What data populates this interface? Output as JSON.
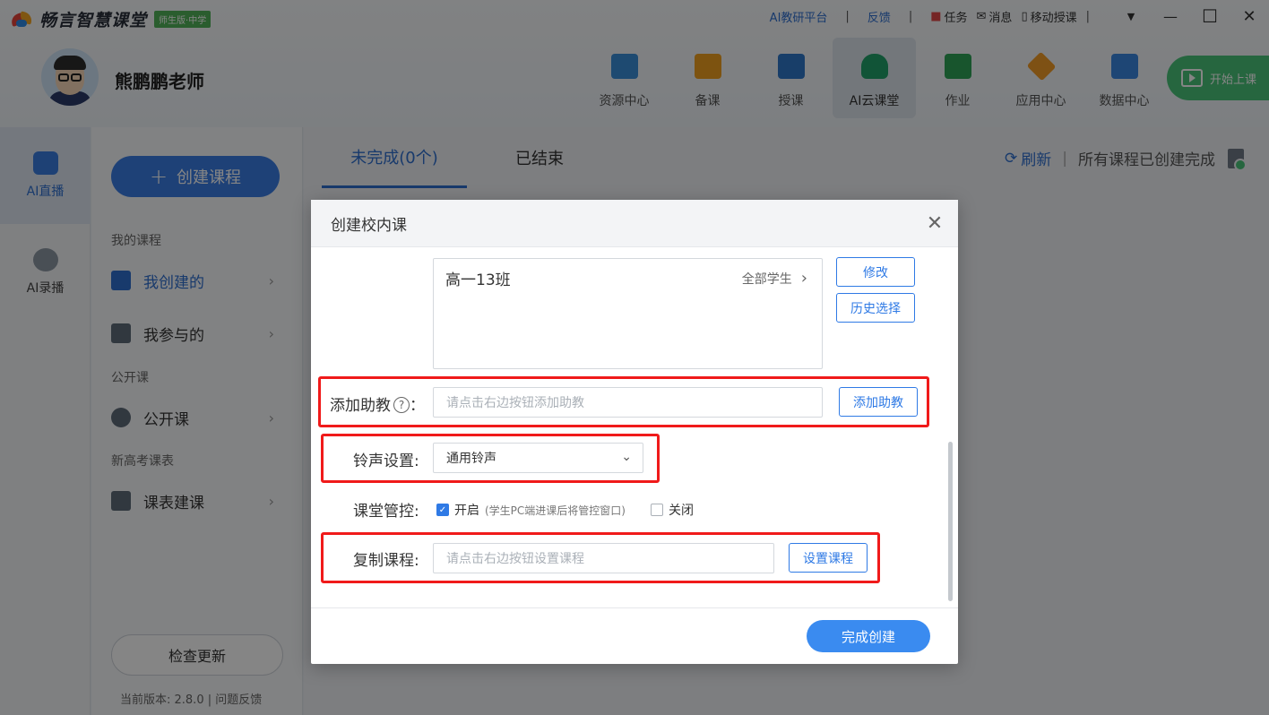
{
  "app": {
    "logo_text": "畅言智慧课堂",
    "badge": "师生版·中学",
    "links": {
      "ai_platform": "AI教研平台",
      "feedback": "反馈",
      "task": "任务",
      "message": "消息",
      "mobile": "移动授课"
    },
    "window_controls": {
      "dropdown": "▼",
      "minimize": "—",
      "maximize": "☐",
      "close": "✕"
    }
  },
  "user": {
    "name": "熊鹏鹏老师"
  },
  "nav": [
    {
      "label": "资源中心",
      "color": "#3b8fd9"
    },
    {
      "label": "备课",
      "color": "#f0a020"
    },
    {
      "label": "授课",
      "color": "#2f78c9"
    },
    {
      "label": "AI云课堂",
      "color": "#22a26a"
    },
    {
      "label": "作业",
      "color": "#2ea357"
    },
    {
      "label": "应用中心",
      "color": "#f29b28"
    },
    {
      "label": "数据中心",
      "color": "#3a86e0"
    }
  ],
  "start_class": "开始上课",
  "rail": [
    {
      "label": "AI直播"
    },
    {
      "label": "AI录播"
    }
  ],
  "sidebar": {
    "create_button": "创建课程",
    "plus": "+",
    "sections": {
      "my_courses": "我的课程",
      "open_class": "公开课",
      "gaokao": "新高考课表"
    },
    "items": {
      "my_created": "我创建的",
      "my_joined": "我参与的",
      "open_class": "公开课",
      "schedule": "课表建课"
    },
    "chevron": "›",
    "check_update": "检查更新",
    "version": "当前版本: 2.8.0 | 问题反馈"
  },
  "main": {
    "tabs": [
      {
        "label": "未完成(0个)"
      },
      {
        "label": "已结束"
      }
    ],
    "refresh": "刷新",
    "refresh_icon": "⟳",
    "separator": "|",
    "status": "所有课程已创建完成"
  },
  "dialog": {
    "title": "创建校内课",
    "close": "✕",
    "class_name": "高一13班",
    "class_scope": "全部学生",
    "scope_chevron": "›",
    "modify": "修改",
    "history": "历史选择",
    "assistant": {
      "label": "添加助教",
      "help": "?",
      "colon": "：",
      "placeholder": "请点击右边按钮添加助教",
      "button": "添加助教"
    },
    "bell": {
      "label": "铃声设置:",
      "value": "通用铃声",
      "chevron": "⌄"
    },
    "control": {
      "label": "课堂管控:",
      "on": "开启",
      "on_hint": "(学生PC端进课后将管控窗口)",
      "off": "关闭",
      "check": "✓"
    },
    "copy": {
      "label": "复制课程:",
      "placeholder": "请点击右边按钮设置课程",
      "button": "设置课程"
    },
    "finish": "完成创建"
  }
}
